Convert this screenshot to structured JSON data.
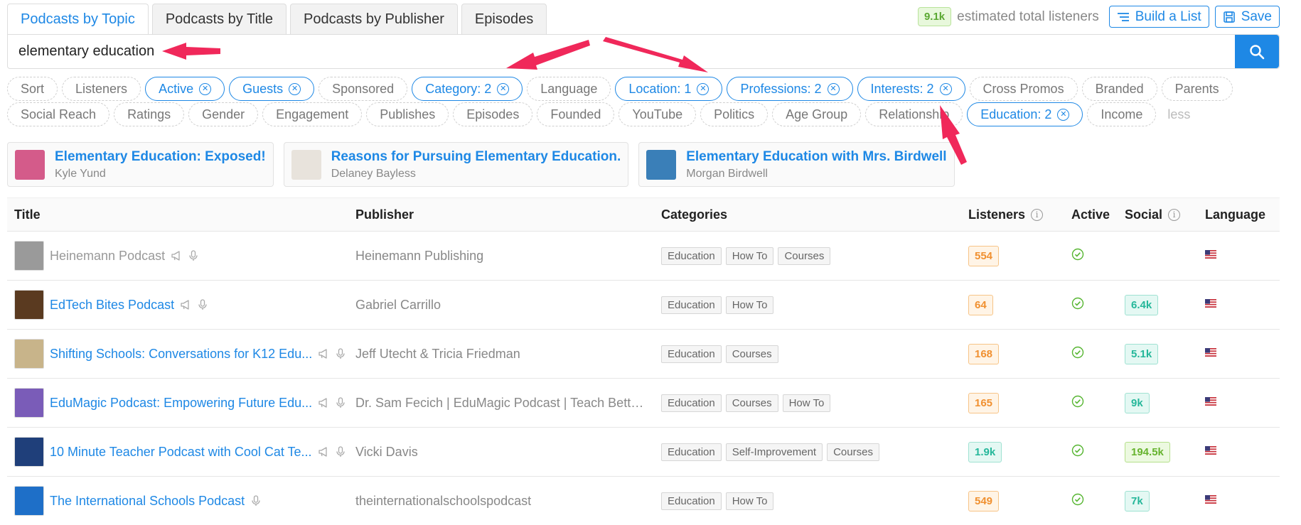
{
  "tabs": [
    {
      "label": "Podcasts by Topic",
      "active": true
    },
    {
      "label": "Podcasts by Title",
      "active": false
    },
    {
      "label": "Podcasts by Publisher",
      "active": false
    },
    {
      "label": "Episodes",
      "active": false
    }
  ],
  "header": {
    "listeners_badge": "9.1k",
    "listeners_text": "estimated total listeners",
    "build_list_label": "Build a List",
    "save_label": "Save"
  },
  "search": {
    "value": "elementary education",
    "icon": "search-icon"
  },
  "filters_row1": [
    {
      "label": "Sort",
      "active": false
    },
    {
      "label": "Listeners",
      "active": false
    },
    {
      "label": "Active",
      "active": true
    },
    {
      "label": "Guests",
      "active": true
    },
    {
      "label": "Sponsored",
      "active": false
    },
    {
      "label": "Category: 2",
      "active": true
    },
    {
      "label": "Language",
      "active": false
    },
    {
      "label": "Location: 1",
      "active": true
    },
    {
      "label": "Professions: 2",
      "active": true
    },
    {
      "label": "Interests: 2",
      "active": true
    },
    {
      "label": "Cross Promos",
      "active": false
    },
    {
      "label": "Branded",
      "active": false
    },
    {
      "label": "Parents",
      "active": false
    }
  ],
  "filters_row2": [
    {
      "label": "Social Reach",
      "active": false
    },
    {
      "label": "Ratings",
      "active": false
    },
    {
      "label": "Gender",
      "active": false
    },
    {
      "label": "Engagement",
      "active": false
    },
    {
      "label": "Publishes",
      "active": false
    },
    {
      "label": "Episodes",
      "active": false
    },
    {
      "label": "Founded",
      "active": false
    },
    {
      "label": "YouTube",
      "active": false
    },
    {
      "label": "Politics",
      "active": false
    },
    {
      "label": "Age Group",
      "active": false
    },
    {
      "label": "Relationship",
      "active": false
    },
    {
      "label": "Education: 2",
      "active": true
    },
    {
      "label": "Income",
      "active": false
    }
  ],
  "less_label": "less",
  "suggested": [
    {
      "title": "Elementary Education: Exposed!",
      "author": "Kyle Yund",
      "color": "#d45b8a"
    },
    {
      "title": "Reasons for Pursuing Elementary Education.",
      "author": "Delaney Bayless",
      "color": "#e8e3dc"
    },
    {
      "title": "Elementary Education with Mrs. Birdwell",
      "author": "Morgan Birdwell",
      "color": "#3a7fb8"
    }
  ],
  "table": {
    "headers": {
      "title": "Title",
      "publisher": "Publisher",
      "categories": "Categories",
      "listeners": "Listeners",
      "active": "Active",
      "social": "Social",
      "language": "Language"
    },
    "rows": [
      {
        "title": "Heinemann Podcast",
        "publisher": "Heinemann Publishing",
        "categories": [
          "Education",
          "How To",
          "Courses"
        ],
        "listeners": "554",
        "listeners_style": "orange",
        "social": "",
        "social_style": "",
        "dim": true,
        "icons": [
          "megaphone-icon",
          "microphone-icon"
        ],
        "thumb_color": "#9a9a9a"
      },
      {
        "title": "EdTech Bites Podcast",
        "publisher": "Gabriel Carrillo",
        "categories": [
          "Education",
          "How To"
        ],
        "listeners": "64",
        "listeners_style": "orange",
        "social": "6.4k",
        "social_style": "teal",
        "dim": false,
        "icons": [
          "megaphone-icon",
          "microphone-icon"
        ],
        "thumb_color": "#5a3a20"
      },
      {
        "title": "Shifting Schools: Conversations for K12 Edu...",
        "publisher": "Jeff Utecht & Tricia Friedman",
        "categories": [
          "Education",
          "Courses"
        ],
        "listeners": "168",
        "listeners_style": "orange",
        "social": "5.1k",
        "social_style": "teal",
        "dim": false,
        "icons": [
          "megaphone-icon",
          "microphone-icon"
        ],
        "thumb_color": "#c8b48a"
      },
      {
        "title": "EduMagic Podcast: Empowering Future Edu...",
        "publisher": "Dr. Sam Fecich | EduMagic Podcast | Teach Better P...",
        "categories": [
          "Education",
          "Courses",
          "How To"
        ],
        "listeners": "165",
        "listeners_style": "orange",
        "social": "9k",
        "social_style": "teal",
        "dim": false,
        "icons": [
          "megaphone-icon",
          "microphone-icon"
        ],
        "thumb_color": "#7a5cb8"
      },
      {
        "title": "10 Minute Teacher Podcast with Cool Cat Te...",
        "publisher": "Vicki Davis",
        "categories": [
          "Education",
          "Self-Improvement",
          "Courses"
        ],
        "listeners": "1.9k",
        "listeners_style": "teal",
        "social": "194.5k",
        "social_style": "green",
        "dim": false,
        "icons": [
          "megaphone-icon",
          "microphone-icon"
        ],
        "thumb_color": "#1f3f7a"
      },
      {
        "title": "The International Schools Podcast",
        "publisher": "theinternationalschoolspodcast",
        "categories": [
          "Education",
          "How To"
        ],
        "listeners": "549",
        "listeners_style": "orange",
        "social": "7k",
        "social_style": "teal",
        "dim": false,
        "icons": [
          "microphone-icon"
        ],
        "thumb_color": "#1e6fc8"
      }
    ]
  },
  "colors": {
    "accent": "#1e88e5",
    "annotation_arrow": "#f0285a"
  }
}
